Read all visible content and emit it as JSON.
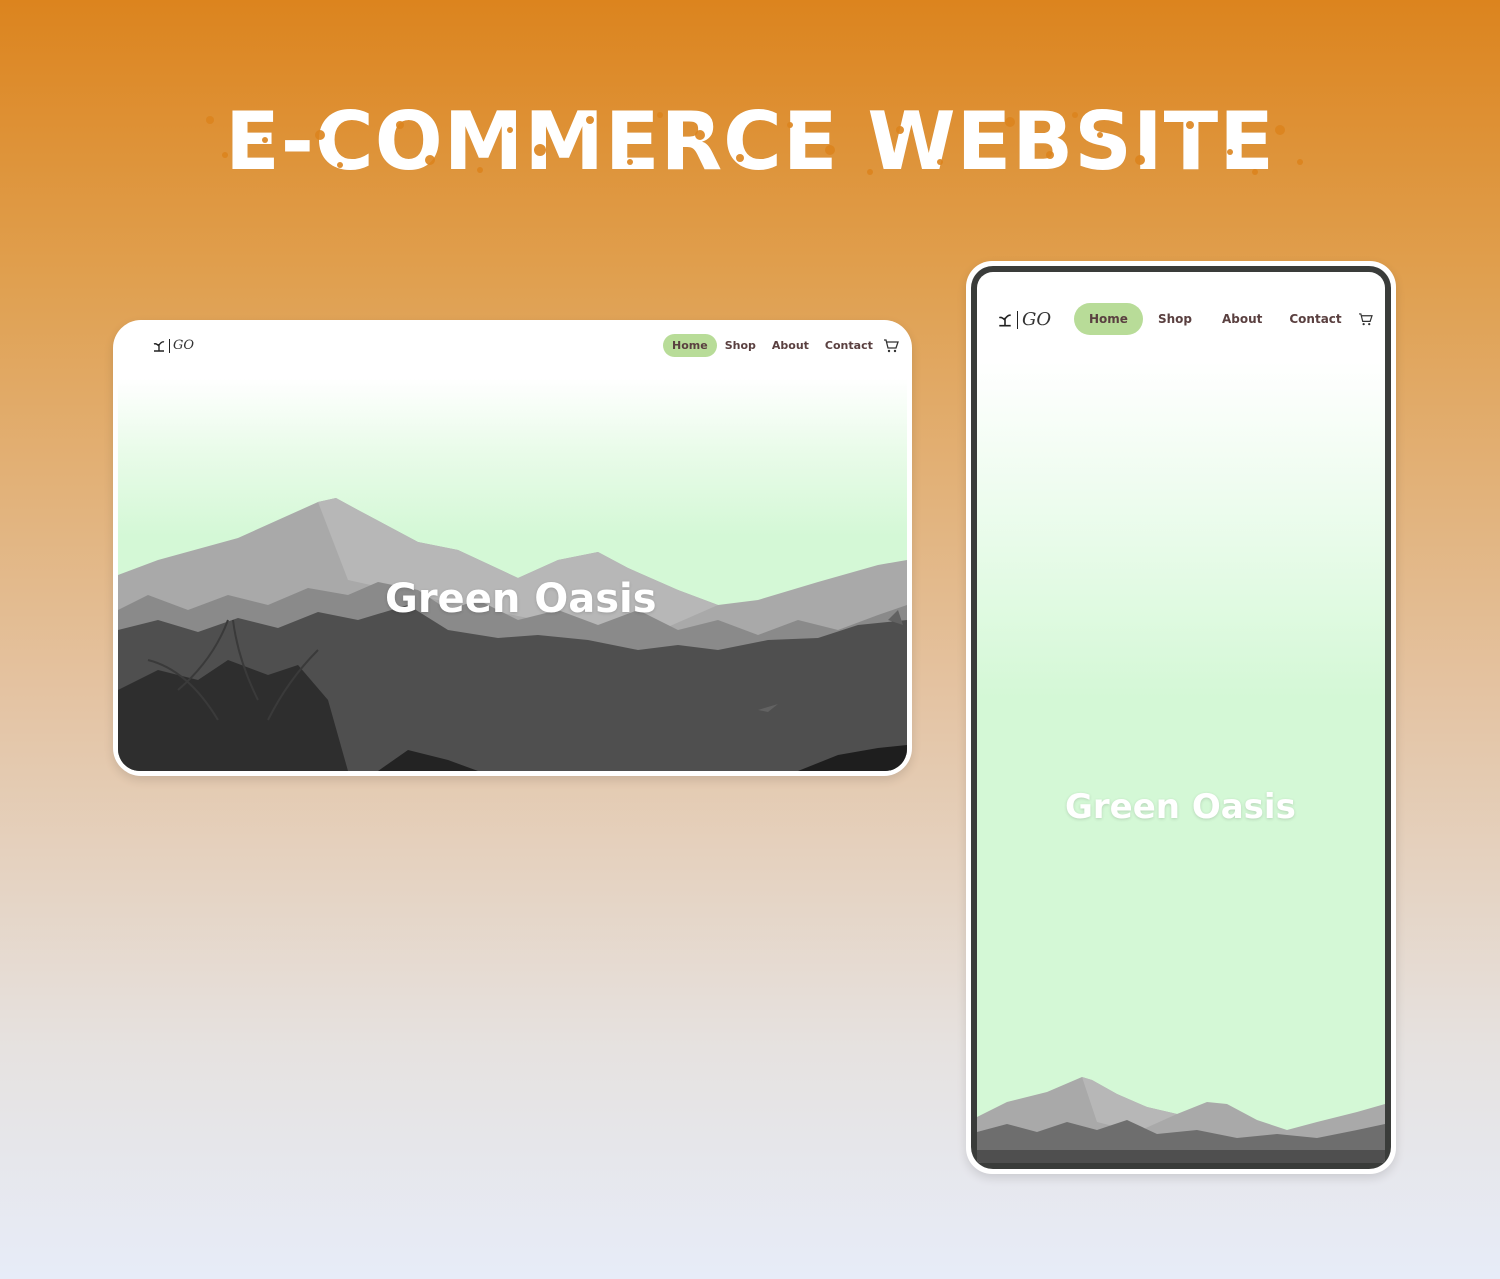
{
  "page": {
    "title": "E-COMMERCE WEBSITE",
    "accent_color": "#dc841e"
  },
  "desktop": {
    "logo": {
      "icon": "plant-icon",
      "text": "GO"
    },
    "nav": {
      "home": "Home",
      "shop": "Shop",
      "about": "About",
      "contact": "Contact",
      "cart_icon": "cart-icon",
      "active_color": "#b8dc98"
    },
    "hero": {
      "title": "Green Oasis"
    }
  },
  "mobile": {
    "logo": {
      "icon": "plant-icon",
      "text": "GO"
    },
    "nav": {
      "home": "Home",
      "shop": "Shop",
      "about": "About",
      "contact": "Contact",
      "cart_icon": "cart-icon"
    },
    "hero": {
      "title": "Green Oasis"
    }
  }
}
